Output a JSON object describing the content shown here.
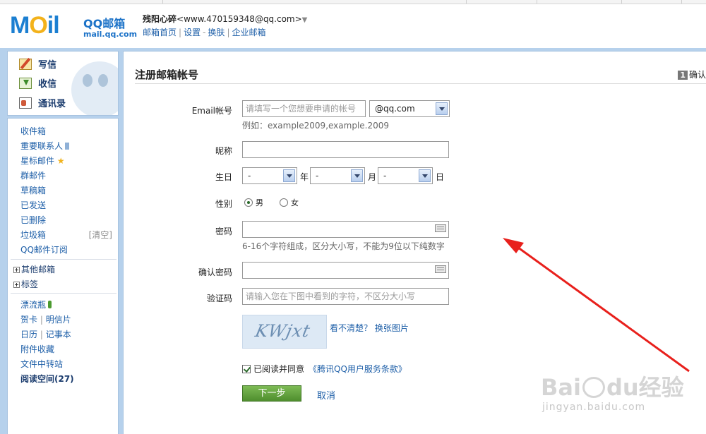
{
  "header": {
    "logo_text": "MOil",
    "logo_cn": "QQ邮箱",
    "logo_domain": "mail.qq.com",
    "user_name": "残阳心碎",
    "user_email": "<www.470159348@qq.com>",
    "links": [
      "邮箱首页",
      "设置",
      "换肤",
      "企业邮箱"
    ]
  },
  "sidebar": {
    "quick": [
      "写信",
      "收信",
      "通讯录"
    ],
    "folders": [
      "收件箱",
      "重要联系人",
      "星标邮件",
      "群邮件",
      "草稿箱",
      "已发送",
      "已删除",
      "垃圾箱",
      "QQ邮件订阅"
    ],
    "trash_clear": "[清空]",
    "groups": [
      "其他邮箱",
      "标签"
    ],
    "apps": [
      "漂流瓶",
      "贺卡",
      "明信片",
      "日历",
      "记事本",
      "附件收藏",
      "文件中转站",
      "阅读空间(27)"
    ]
  },
  "form": {
    "title": "注册邮箱帐号",
    "step_num": "1",
    "step_text": "确认",
    "email_label": "Email帐号",
    "email_placeholder": "请填写一个您想要申请的帐号",
    "domain_value": "@qq.com",
    "email_hint": "例如：example2009,example.2009",
    "nickname_label": "昵称",
    "birthday_label": "生日",
    "birth_year": "-",
    "birth_month": "-",
    "birth_day": "-",
    "unit_year": "年",
    "unit_month": "月",
    "unit_day": "日",
    "gender_label": "性别",
    "gender_male": "男",
    "gender_female": "女",
    "password_label": "密码",
    "password_hint": "6-16个字符组成，区分大小写，不能为9位以下纯数字",
    "confirm_label": "确认密码",
    "captcha_label": "验证码",
    "captcha_placeholder": "请输入您在下图中看到的字符，不区分大小写",
    "captcha_image_text": "KWjxt",
    "captcha_refresh": "看不清楚？ 换张图片",
    "agree_text": "已阅读并同意",
    "tos_link": "《腾讯QQ用户服务条款》",
    "next_label": "下一步",
    "cancel_label": "取消"
  },
  "watermark": {
    "brand": "Bai",
    "brand2": "du",
    "cn": "经验",
    "url": "jingyan.baidu.com"
  },
  "colors": {
    "band": "#b6d1ec",
    "link": "#1e5fa8",
    "button_green": "#5a9a36",
    "annotation": "#e8201c"
  }
}
